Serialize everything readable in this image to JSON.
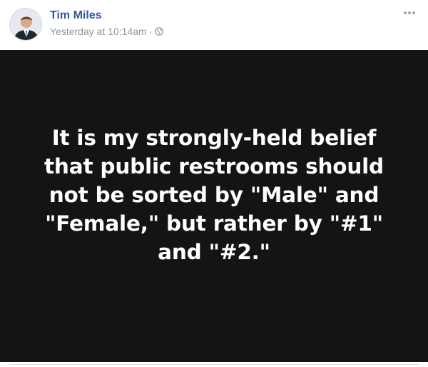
{
  "post": {
    "author": "Tim Miles",
    "timestamp": "Yesterday at 10:14am",
    "separator": "·",
    "privacy_icon": "globe-icon",
    "menu_icon": "more-options-icon",
    "image_text_lines": [
      "It is my strongly-held belief",
      "that public restrooms should",
      "not be sorted by \"Male\" and",
      "\"Female,\" but rather by \"#1\"",
      "and \"#2.\""
    ]
  },
  "colors": {
    "author_link": "#365899",
    "meta_text": "#90949c",
    "image_background": "#141414",
    "image_text": "#ffffff"
  }
}
